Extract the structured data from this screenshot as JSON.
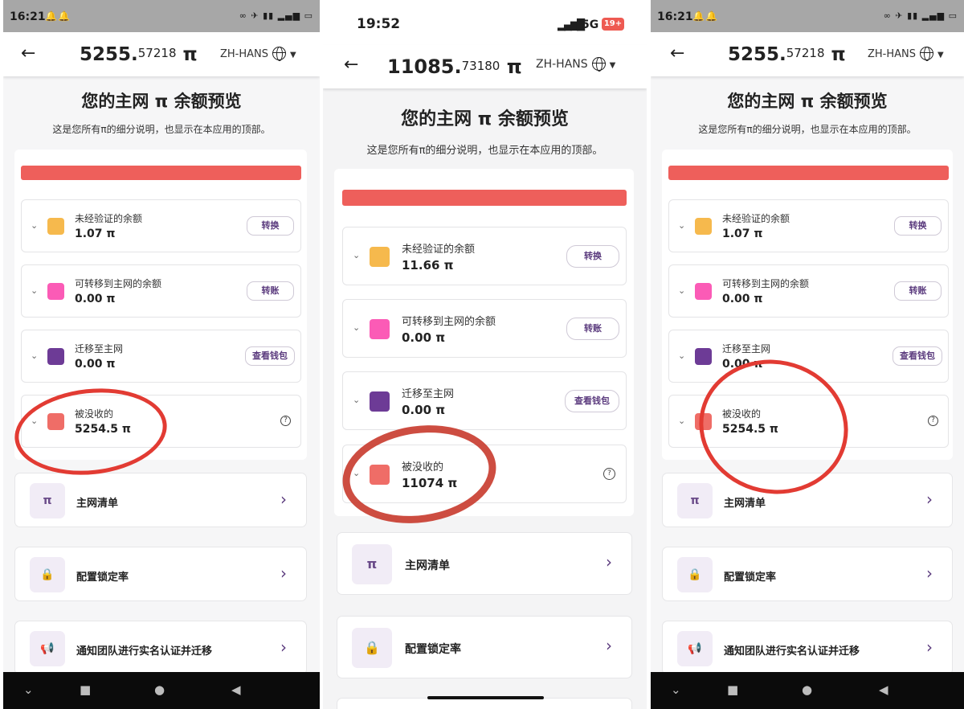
{
  "colors": {
    "unverified": "#f6b94d",
    "transferable": "#fb5bb6",
    "migrated": "#6d3b96",
    "confiscated": "#ef6d67",
    "red_bar": "#ee5f5b",
    "accent": "#5b3b7e",
    "annotation_circle": "#e23b33"
  },
  "icons": [
    "back-arrow-icon",
    "globe-icon",
    "caret-down-icon",
    "chevron-down-icon",
    "help-circle-icon",
    "chevron-right-icon",
    "clipboard-pi-icon",
    "lock-icon",
    "megaphone-icon"
  ],
  "screens": [
    {
      "status": {
        "time": "16:21"
      },
      "balance": {
        "int": "5255.",
        "dec": "57218",
        "unit": "π"
      },
      "lang": "ZH-HANS",
      "title": "您的主网 π 余额预览",
      "subtitle": "这是您所有π的细分说明，也显示在本应用的顶部。",
      "rows": [
        {
          "label": "未经验证的余额",
          "value": "1.07 π",
          "button": "转换"
        },
        {
          "label": "可转移到主网的余额",
          "value": "0.00 π",
          "button": "转账"
        },
        {
          "label": "迁移至主网",
          "value": "0.00 π",
          "button": "查看钱包"
        },
        {
          "label": "被没收的",
          "value": "5254.5 π"
        }
      ],
      "nav": [
        "主网清单",
        "配置锁定率",
        "通知团队进行实名认证并迁移"
      ]
    },
    {
      "status": {
        "time": "19:52",
        "network": "5G",
        "battery": "19+"
      },
      "balance": {
        "int": "11085.",
        "dec": "73180",
        "unit": "π"
      },
      "lang": "ZH-HANS",
      "title": "您的主网 π 余额预览",
      "subtitle": "这是您所有π的细分说明，也显示在本应用的顶部。",
      "rows": [
        {
          "label": "未经验证的余额",
          "value": "11.66 π",
          "button": "转换"
        },
        {
          "label": "可转移到主网的余额",
          "value": "0.00 π",
          "button": "转账"
        },
        {
          "label": "迁移至主网",
          "value": "0.00 π",
          "button": "查看钱包"
        },
        {
          "label": "被没收的",
          "value": "11074 π"
        }
      ],
      "nav": [
        "主网清单",
        "配置锁定率"
      ]
    },
    {
      "status": {
        "time": "16:21"
      },
      "balance": {
        "int": "5255.",
        "dec": "57218",
        "unit": "π"
      },
      "lang": "ZH-HANS",
      "title": "您的主网 π 余额预览",
      "subtitle": "这是您所有π的细分说明，也显示在本应用的顶部。",
      "rows": [
        {
          "label": "未经验证的余额",
          "value": "1.07 π",
          "button": "转换"
        },
        {
          "label": "可转移到主网的余额",
          "value": "0.00 π",
          "button": "转账"
        },
        {
          "label": "迁移至主网",
          "value": "0.00 π",
          "button": "查看钱包"
        },
        {
          "label": "被没收的",
          "value": "5254.5 π"
        }
      ],
      "nav": [
        "主网清单",
        "配置锁定率",
        "通知团队进行实名认证并迁移"
      ]
    }
  ]
}
